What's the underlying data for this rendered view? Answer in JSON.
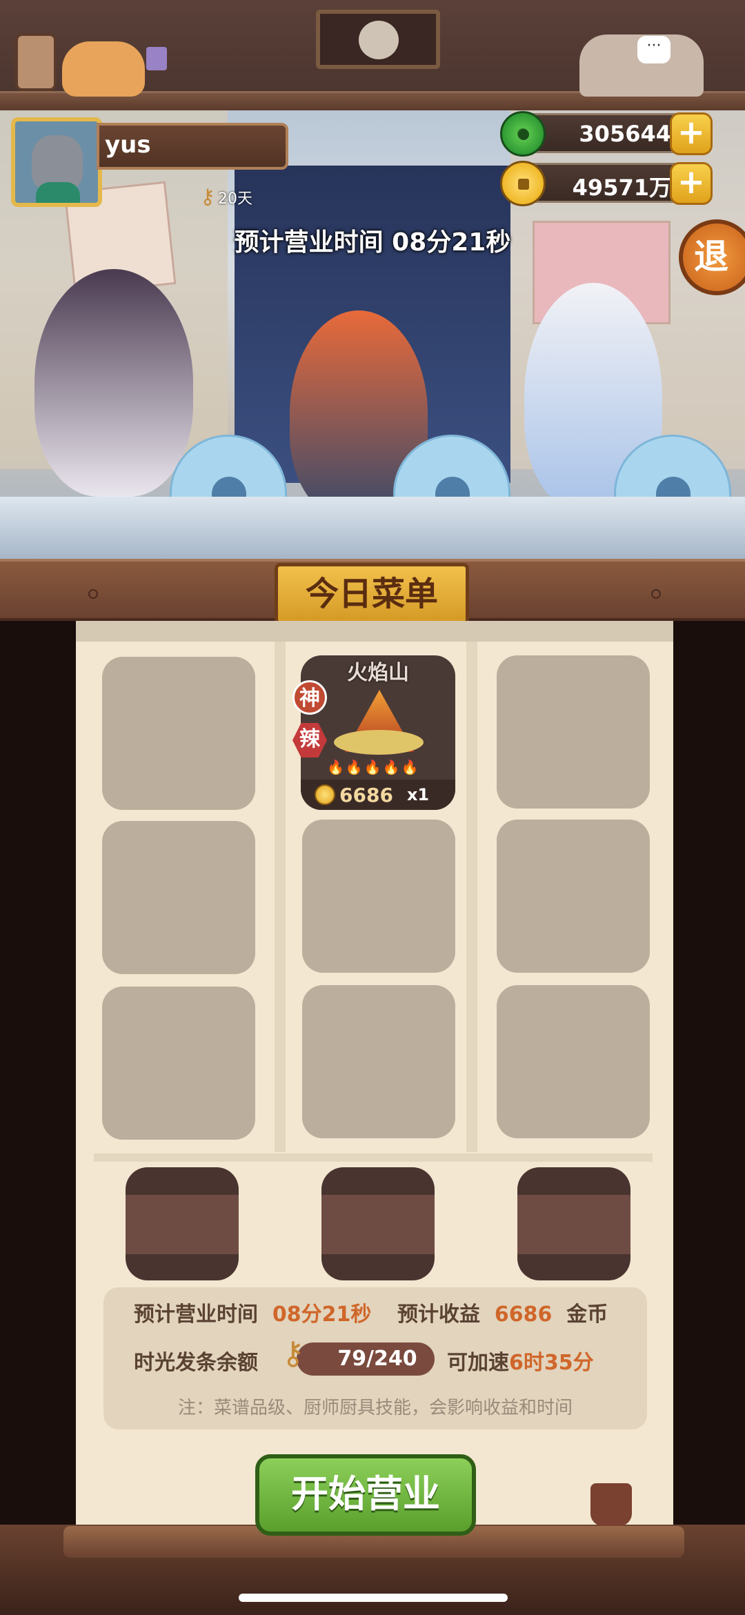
{
  "player": {
    "name": "yus",
    "days_label": "20天"
  },
  "currency": {
    "jade": "305644",
    "coins": "49571万",
    "plus_label": "+"
  },
  "scene": {
    "business_time": "预计营业时间  08分21秒",
    "exit_label": "退"
  },
  "menu": {
    "title": "今日菜单",
    "dish": {
      "name": "火焰山",
      "tag_god": "神",
      "tag_spicy": "辣",
      "heat": "🔥🔥🔥🔥🔥",
      "price": "6686",
      "multiplier": "x1"
    }
  },
  "info": {
    "time_label": "预计营业时间",
    "time_value": "08分21秒",
    "income_label": "预计收益",
    "income_value": "6686",
    "income_unit": "金币",
    "balance_label": "时光发条余额",
    "balance_value": "79/240",
    "speedup_label": "可加速",
    "speedup_value": "6时35分",
    "note": "注：菜谱品级、厨师厨具技能，会影响收益和时间"
  },
  "actions": {
    "start_label": "开始营业"
  },
  "colors": {
    "highlight": "#d0662a",
    "start_button": "#6fb23e",
    "gold": "#e4b84a"
  }
}
